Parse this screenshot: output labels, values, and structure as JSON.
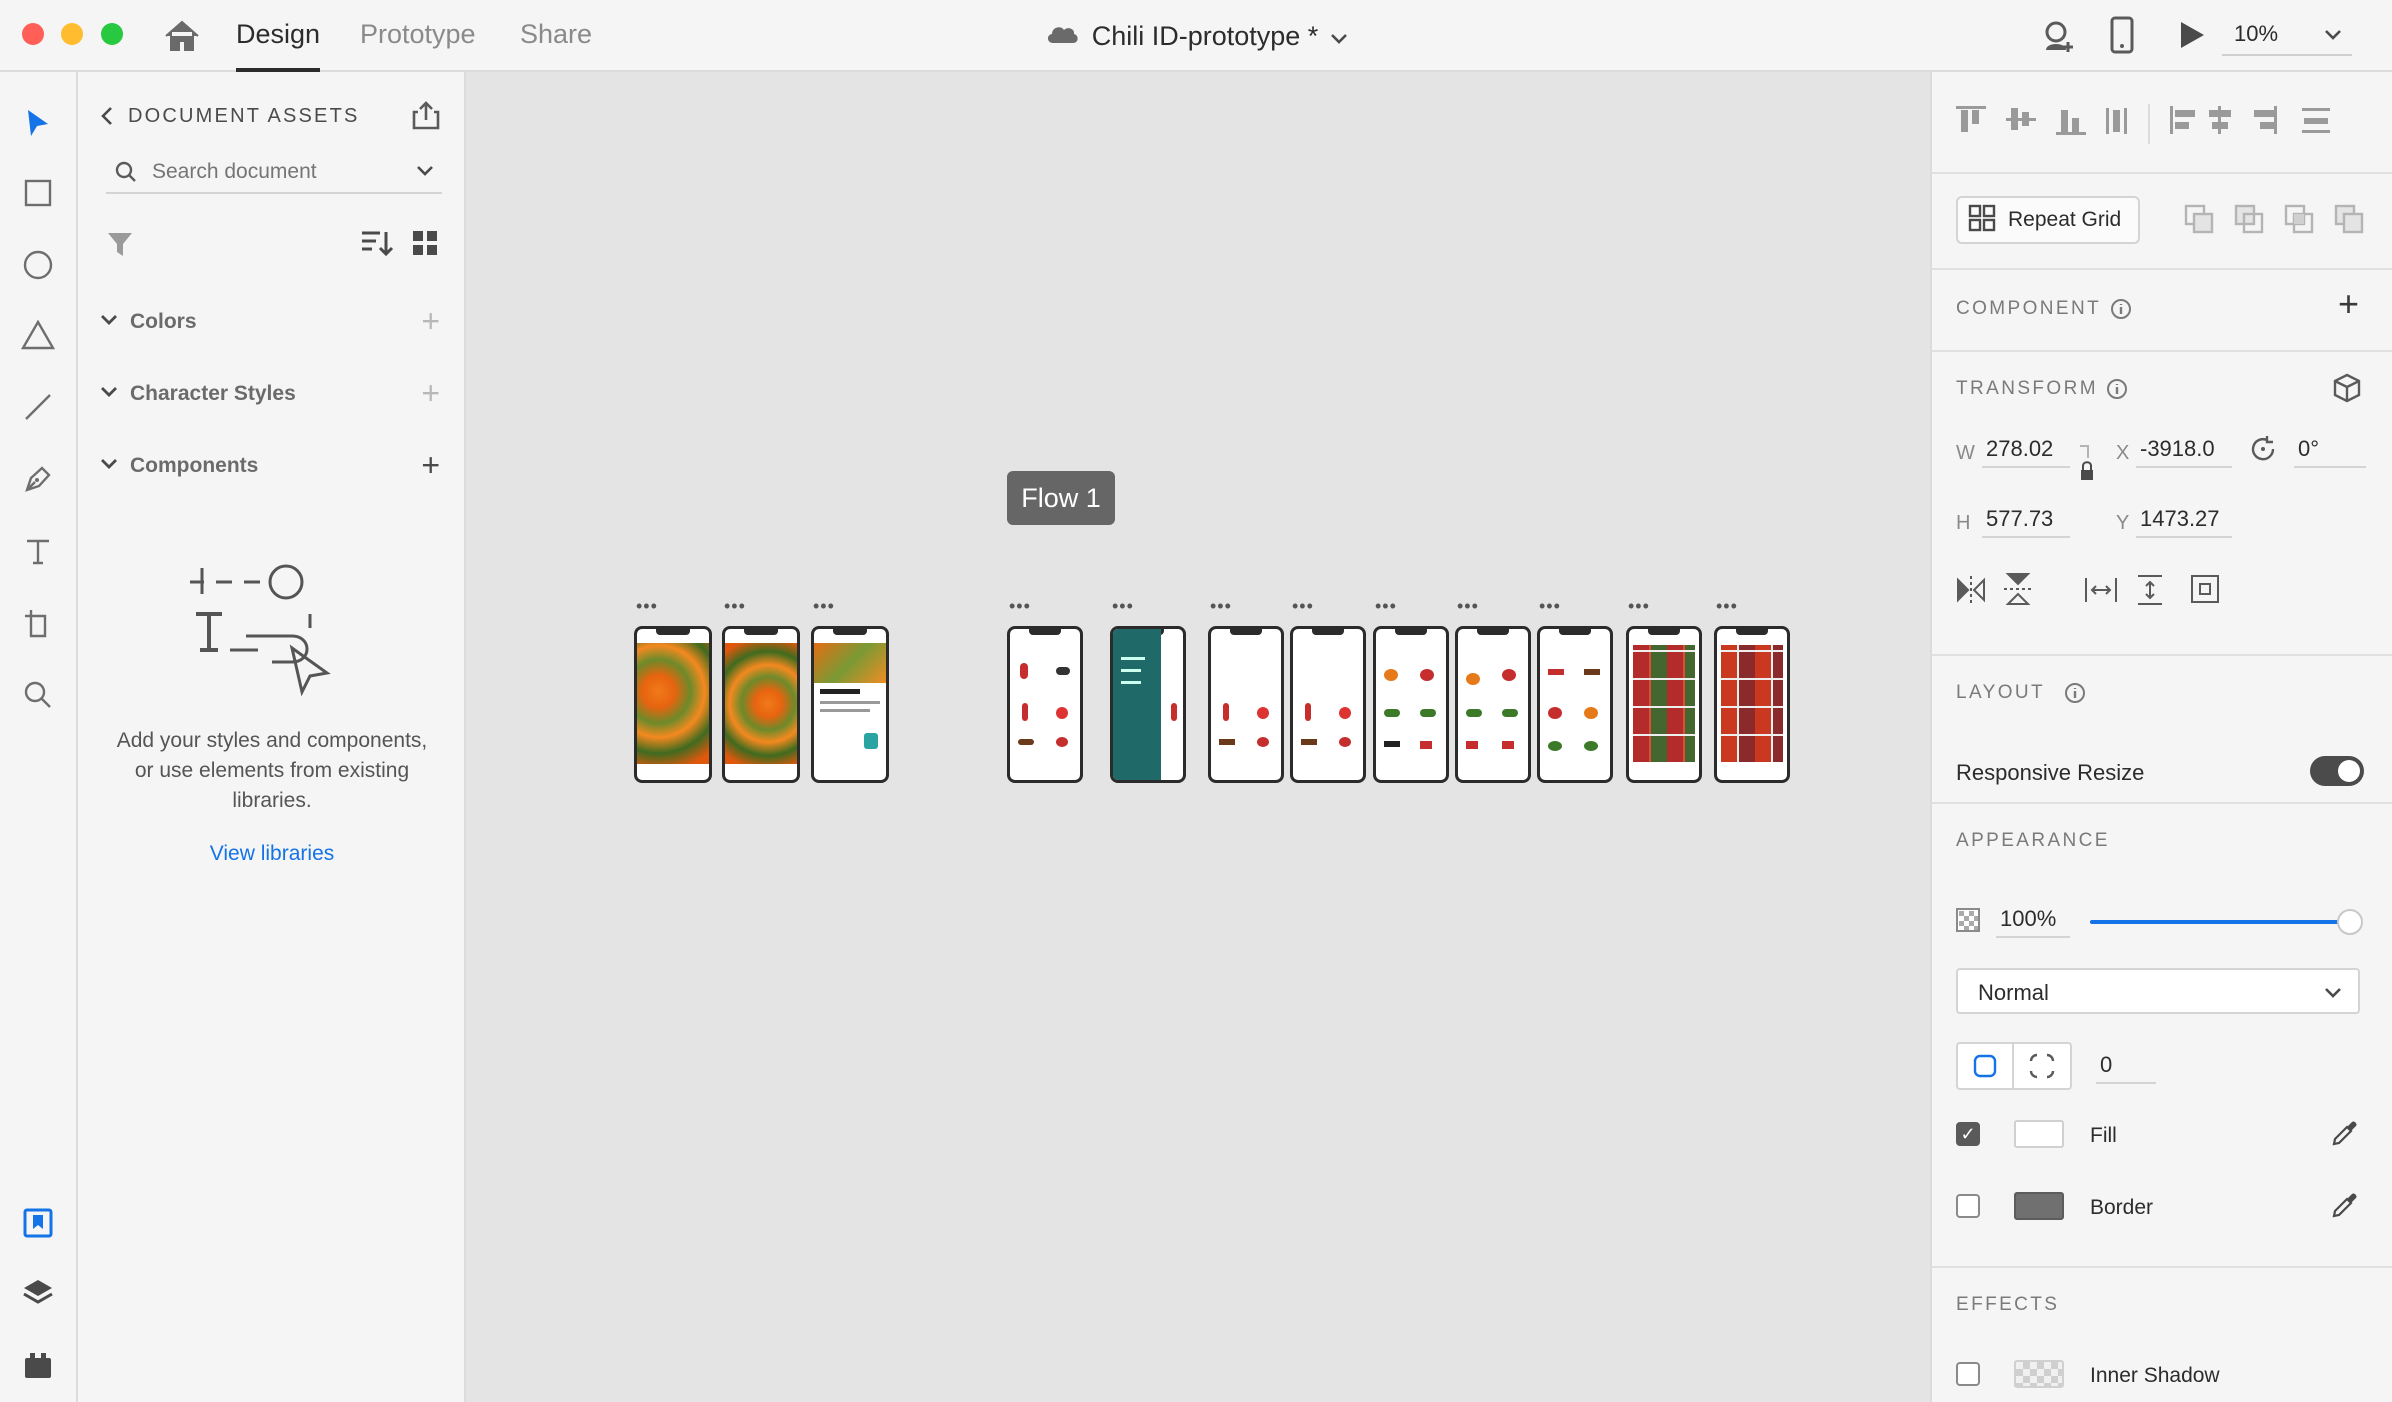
{
  "titlebar": {
    "tabs": [
      {
        "label": "Design",
        "active": true
      },
      {
        "label": "Prototype",
        "active": false
      },
      {
        "label": "Share",
        "active": false
      }
    ],
    "document_title": "Chili ID-prototype *",
    "zoom": "10%"
  },
  "tools": [
    "select-icon",
    "rectangle-icon",
    "ellipse-icon",
    "triangle-icon",
    "line-icon",
    "pen-icon",
    "text-icon",
    "artboard-icon",
    "zoom-tool-icon"
  ],
  "assets": {
    "header": "DOCUMENT ASSETS",
    "search_placeholder": "Search document",
    "sections": [
      {
        "label": "Colors"
      },
      {
        "label": "Character Styles"
      },
      {
        "label": "Components"
      }
    ],
    "empty_message_line1": "Add your styles and components,",
    "empty_message_line2": "or use elements from existing",
    "empty_message_line3": "libraries.",
    "view_libraries": "View libraries"
  },
  "canvas": {
    "flow_label": "Flow 1",
    "artboard_ellipsis": "•••"
  },
  "properties": {
    "repeat_grid": "Repeat Grid",
    "component_title": "COMPONENT",
    "transform_title": "TRANSFORM",
    "w_label": "W",
    "w_value": "278.02",
    "x_label": "X",
    "x_value": "-3918.0",
    "rotation_value": "0°",
    "h_label": "H",
    "h_value": "577.73",
    "y_label": "Y",
    "y_value": "1473.27",
    "layout_title": "LAYOUT",
    "responsive_resize": "Responsive Resize",
    "responsive_resize_on": true,
    "appearance_title": "APPEARANCE",
    "opacity_value": "100%",
    "opacity_fraction": 1.0,
    "blend_mode": "Normal",
    "corner_radius": "0",
    "fill_label": "Fill",
    "fill_checked": true,
    "fill_color": "#ffffff",
    "border_label": "Border",
    "border_checked": false,
    "border_color": "#707070",
    "effects_title": "EFFECTS",
    "inner_shadow_label": "Inner Shadow",
    "inner_shadow_checked": false
  },
  "colors": {
    "accent": "#1473e6",
    "toggle_on": "#4b4b4b",
    "traffic_red": "#ff5f57",
    "traffic_yellow": "#febc2e",
    "traffic_green": "#28c840"
  }
}
